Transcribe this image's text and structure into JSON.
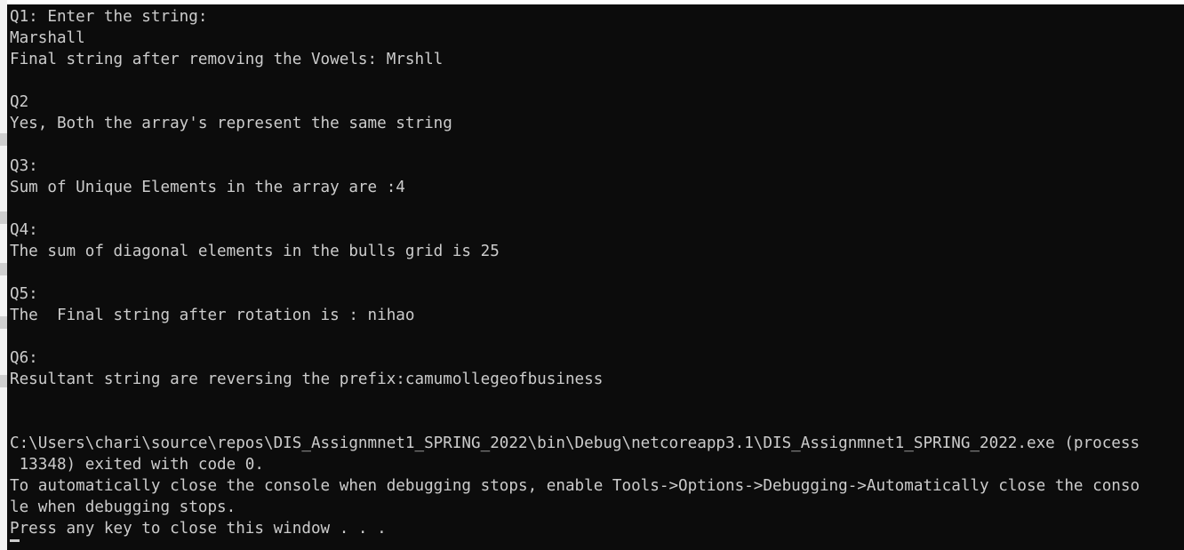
{
  "console": {
    "lines": [
      "Q1: Enter the string:",
      "Marshall",
      "Final string after removing the Vowels: Mrshll",
      "",
      "Q2",
      "Yes, Both the array's represent the same string",
      "",
      "Q3:",
      "Sum of Unique Elements in the array are :4",
      "",
      "Q4:",
      "The sum of diagonal elements in the bulls grid is 25",
      "",
      "Q5:",
      "The  Final string after rotation is : nihao",
      "",
      "Q6:",
      "Resultant string are reversing the prefix:camumollegeofbusiness",
      "",
      "",
      "C:\\Users\\chari\\source\\repos\\DIS_Assignmnet1_SPRING_2022\\bin\\Debug\\netcoreapp3.1\\DIS_Assignmnet1_SPRING_2022.exe (process",
      " 13348) exited with code 0.",
      "To automatically close the console when debugging stops, enable Tools->Options->Debugging->Automatically close the conso",
      "le when debugging stops.",
      "Press any key to close this window . . ."
    ]
  }
}
